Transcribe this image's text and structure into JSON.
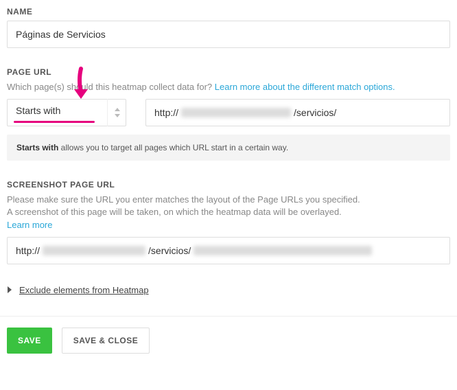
{
  "name": {
    "label": "NAME",
    "value": "Páginas de Servicios"
  },
  "page_url": {
    "label": "PAGE URL",
    "helper": "Which page(s) should this heatmap collect data for?",
    "learn_more": "Learn more about the different match options.",
    "match_type": "Starts with",
    "protocol": "http://",
    "path": "/servicios/",
    "note_bold": "Starts with",
    "note_rest": " allows you to target all pages which URL start in a certain way."
  },
  "screenshot_url": {
    "label": "SCREENSHOT PAGE URL",
    "helper_line1": "Please make sure the URL you enter matches the layout of the Page URLs you specified.",
    "helper_line2": "A screenshot of this page will be taken, on which the heatmap data will be overlayed.",
    "learn_more": "Learn more",
    "protocol": "http://",
    "path": "/servicios/"
  },
  "expander": {
    "label": "Exclude elements from Heatmap"
  },
  "buttons": {
    "save": "SAVE",
    "save_close": "SAVE & CLOSE"
  }
}
